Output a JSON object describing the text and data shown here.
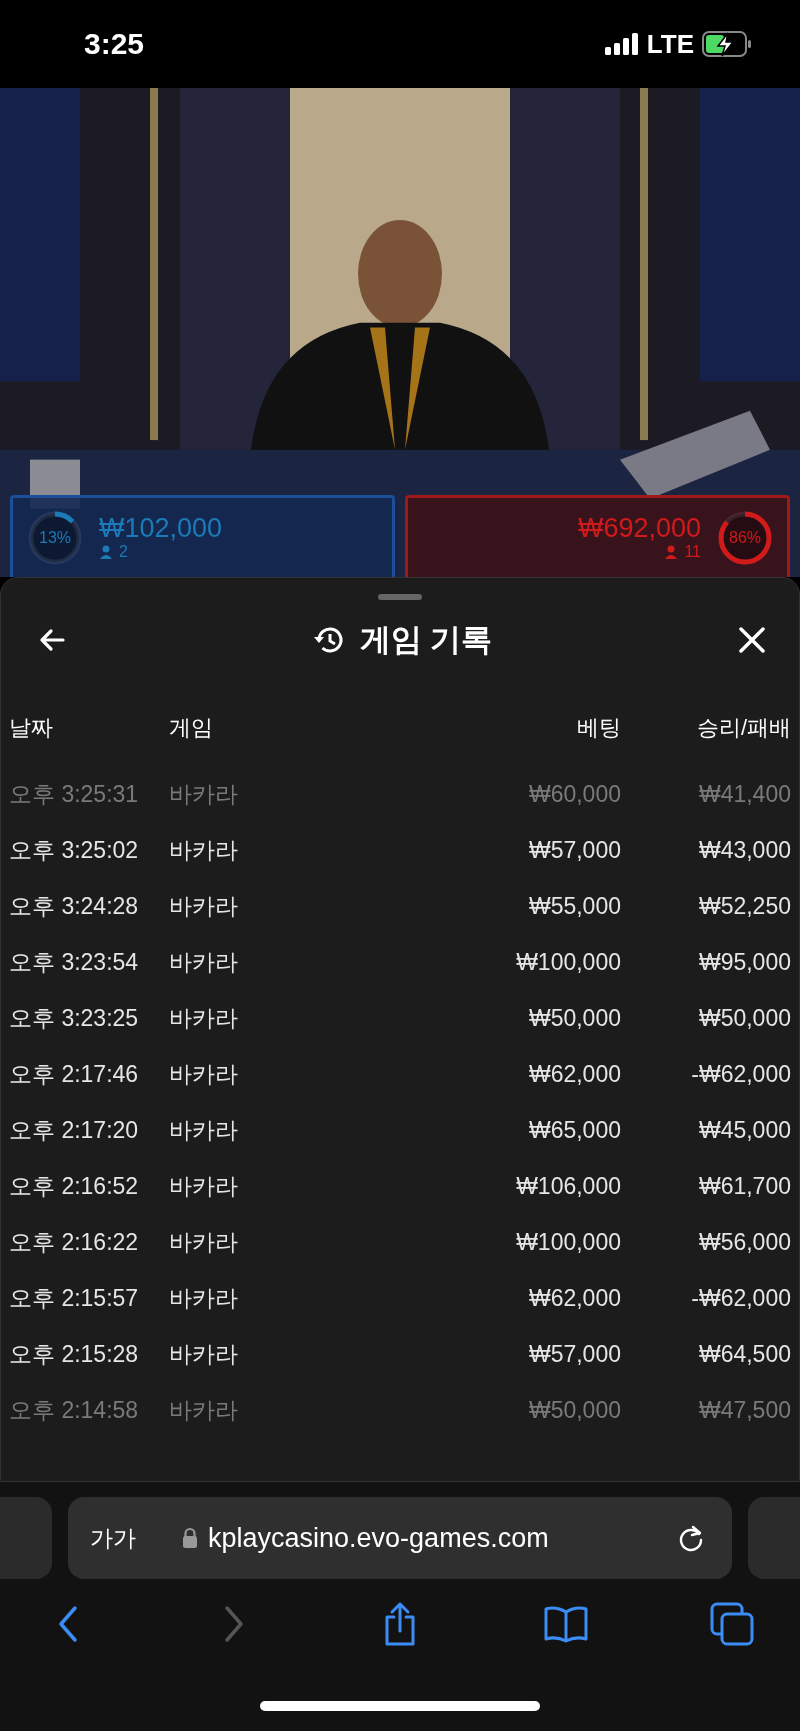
{
  "status_bar": {
    "time": "3:25",
    "network": "LTE"
  },
  "bet_panels": [
    {
      "kind": "player",
      "percent": "13%",
      "level": 0.13,
      "amount": "₩102,000",
      "players": "2"
    },
    {
      "kind": "banker",
      "percent": "86%",
      "level": 0.86,
      "amount": "₩692,000",
      "players": "11"
    }
  ],
  "sheet": {
    "title": "게임 기록",
    "columns": [
      "날짜",
      "게임",
      "베팅",
      "승리/패배"
    ],
    "rows": [
      {
        "date": "오후 3:25:31",
        "game": "바카라",
        "bet": "₩60,000",
        "result": "₩41,400",
        "dimmed": true
      },
      {
        "date": "오후 3:25:02",
        "game": "바카라",
        "bet": "₩57,000",
        "result": "₩43,000",
        "dimmed": false
      },
      {
        "date": "오후 3:24:28",
        "game": "바카라",
        "bet": "₩55,000",
        "result": "₩52,250",
        "dimmed": false
      },
      {
        "date": "오후 3:23:54",
        "game": "바카라",
        "bet": "₩100,000",
        "result": "₩95,000",
        "dimmed": false
      },
      {
        "date": "오후 3:23:25",
        "game": "바카라",
        "bet": "₩50,000",
        "result": "₩50,000",
        "dimmed": false
      },
      {
        "date": "오후 2:17:46",
        "game": "바카라",
        "bet": "₩62,000",
        "result": "-₩62,000",
        "dimmed": false
      },
      {
        "date": "오후 2:17:20",
        "game": "바카라",
        "bet": "₩65,000",
        "result": "₩45,000",
        "dimmed": false
      },
      {
        "date": "오후 2:16:52",
        "game": "바카라",
        "bet": "₩106,000",
        "result": "₩61,700",
        "dimmed": false
      },
      {
        "date": "오후 2:16:22",
        "game": "바카라",
        "bet": "₩100,000",
        "result": "₩56,000",
        "dimmed": false
      },
      {
        "date": "오후 2:15:57",
        "game": "바카라",
        "bet": "₩62,000",
        "result": "-₩62,000",
        "dimmed": false
      },
      {
        "date": "오후 2:15:28",
        "game": "바카라",
        "bet": "₩57,000",
        "result": "₩64,500",
        "dimmed": false
      },
      {
        "date": "오후 2:14:58",
        "game": "바카라",
        "bet": "₩50,000",
        "result": "₩47,500",
        "dimmed": true
      }
    ]
  },
  "browser": {
    "text_size": "가가",
    "url": "kplaycasino.evo-games.com",
    "toolbar": [
      {
        "kind": "back",
        "disabled": false
      },
      {
        "kind": "forward",
        "disabled": true
      },
      {
        "kind": "share",
        "disabled": false
      },
      {
        "kind": "bookmarks",
        "disabled": false
      },
      {
        "kind": "tabs",
        "disabled": false
      }
    ]
  }
}
